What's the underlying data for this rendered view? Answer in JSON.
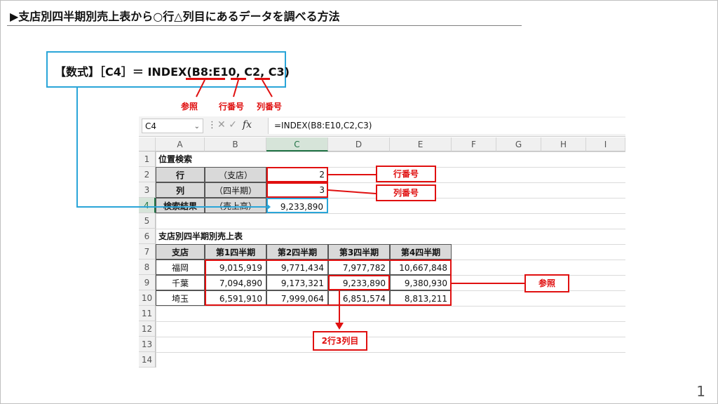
{
  "slide": {
    "title": "▶支店別四半期別売上表から○行△列目にあるデータを調べる方法",
    "page_number": "1"
  },
  "formula_box": {
    "prefix": "【数式】［C4］＝ INDEX(",
    "arg1": "B8:E10",
    "sep1": ", ",
    "arg2": "C2",
    "sep2": ", ",
    "arg3": "C3",
    "suffix": ")",
    "label_ref": "参照",
    "label_row": "行番号",
    "label_col": "列番号"
  },
  "excel": {
    "name_box": "C4",
    "formula": "=INDEX(B8:E10,C2,C3)",
    "columns": [
      "A",
      "B",
      "C",
      "D",
      "E",
      "F",
      "G",
      "H",
      "I"
    ],
    "rows": [
      "1",
      "2",
      "3",
      "4",
      "5",
      "6",
      "7",
      "8",
      "9",
      "10",
      "11",
      "12",
      "13",
      "14"
    ],
    "a1": "位置検索",
    "a2": "行",
    "b2": "（支店）",
    "c2": "2",
    "a3": "列",
    "b3": "（四半期）",
    "c3": "3",
    "a4": "検索結果",
    "b4": "（売上高）",
    "c4": "9,233,890",
    "a6": "支店別四半期別売上表",
    "table_headers": [
      "支店",
      "第1四半期",
      "第2四半期",
      "第3四半期",
      "第4四半期"
    ],
    "table_rows": [
      {
        "branch": "福岡",
        "q1": "9,015,919",
        "q2": "9,771,434",
        "q3": "7,977,782",
        "q4": "10,667,848"
      },
      {
        "branch": "千葉",
        "q1": "7,094,890",
        "q2": "9,173,321",
        "q3": "9,233,890",
        "q4": "9,380,930"
      },
      {
        "branch": "埼玉",
        "q1": "6,591,910",
        "q2": "7,999,064",
        "q3": "6,851,574",
        "q4": "8,813,211"
      }
    ]
  },
  "callouts": {
    "row_num": "行番号",
    "col_num": "列番号",
    "ref": "参照",
    "pos": "2行3列目"
  },
  "colors": {
    "accent_red": "#e01010",
    "accent_blue": "#2aa5d8",
    "excel_green": "#217346"
  }
}
